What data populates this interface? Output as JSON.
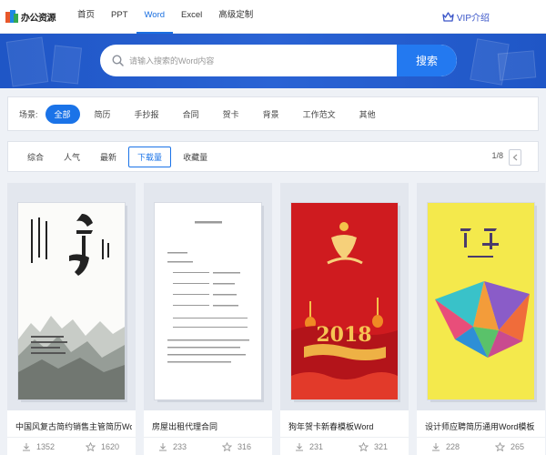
{
  "app": {
    "logo_text": "办公资源"
  },
  "nav": {
    "items": [
      {
        "label": "首页"
      },
      {
        "label": "PPT"
      },
      {
        "label": "Word"
      },
      {
        "label": "Excel"
      },
      {
        "label": "高级定制"
      }
    ],
    "active": "Word",
    "vip_label": "VIP介绍"
  },
  "search": {
    "placeholder": "请输入搜索的Word内容",
    "button_label": "搜索"
  },
  "scene": {
    "label": "场景:",
    "options": [
      "全部",
      "简历",
      "手抄报",
      "合同",
      "贺卡",
      "背景",
      "工作范文",
      "其他"
    ],
    "active": "全部"
  },
  "sort": {
    "options": [
      "综合",
      "人气",
      "最新",
      "下载量",
      "收藏量"
    ],
    "active": "下载量",
    "page_indicator": "1/8"
  },
  "cards": [
    {
      "title": "中国风复古简约销售主管简历Wor...",
      "downloads": "1352",
      "favorites": "1620",
      "thumb_theme": "ink-landscape-resume"
    },
    {
      "title": "房屋出租代理合同",
      "downloads": "233",
      "favorites": "316",
      "thumb_theme": "contract-document"
    },
    {
      "title": "狗年贺卡新春模板Word",
      "downloads": "231",
      "favorites": "321",
      "thumb_theme": "red-new-year-card"
    },
    {
      "title": "设计师应聘简历通用Word模板",
      "downloads": "228",
      "favorites": "265",
      "thumb_theme": "yellow-geometric-resume"
    }
  ],
  "colors": {
    "accent": "#1a73e8",
    "banner": "#2a63d4",
    "search_button": "#2379f0"
  }
}
